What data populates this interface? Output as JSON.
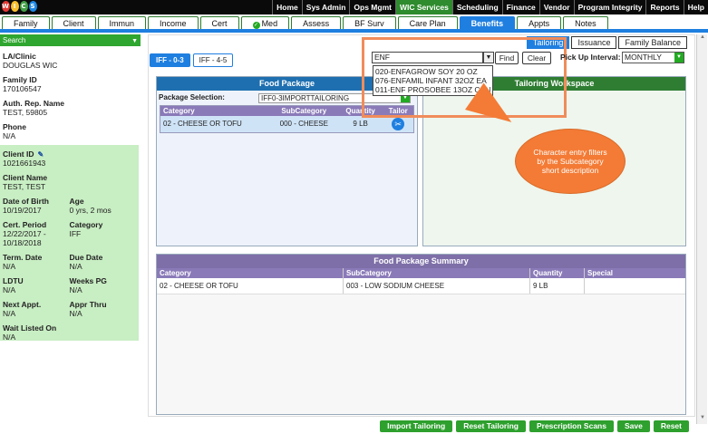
{
  "logo": {
    "text": "WIC"
  },
  "top_menu": [
    "Home",
    "Sys Admin",
    "Ops Mgmt",
    "WIC Services",
    "Scheduling",
    "Finance",
    "Vendor",
    "Program Integrity",
    "Reports",
    "Help"
  ],
  "top_menu_active": "WIC Services",
  "tabs": [
    "Family",
    "Client",
    "Immun",
    "Income",
    "Cert",
    "Med",
    "Assess",
    "BF Surv",
    "Care Plan",
    "Benefits",
    "Appts",
    "Notes"
  ],
  "tabs_active": "Benefits",
  "sidebar": {
    "search_label": "Search",
    "la_clinic_label": "LA/Clinic",
    "la_clinic_value": "DOUGLAS WIC",
    "family_id_label": "Family ID",
    "family_id_value": "170106547",
    "auth_rep_label": "Auth. Rep. Name",
    "auth_rep_value": "TEST, 59805",
    "phone_label": "Phone",
    "phone_value": "N/A",
    "client_id_label": "Client ID",
    "client_id_value": "1021661943",
    "client_name_label": "Client Name",
    "client_name_value": "TEST, TEST",
    "dob_label": "Date of Birth",
    "dob_value": "10/19/2017",
    "age_label": "Age",
    "age_value": "0 yrs, 2 mos",
    "cert_period_label": "Cert. Period",
    "cert_period_value1": "12/22/2017 -",
    "cert_period_value2": "10/18/2018",
    "category_label": "Category",
    "category_value": "IFF",
    "term_date_label": "Term. Date",
    "term_date_value": "N/A",
    "due_date_label": "Due Date",
    "due_date_value": "N/A",
    "ldtu_label": "LDTU",
    "ldtu_value": "N/A",
    "weeks_pg_label": "Weeks PG",
    "weeks_pg_value": "N/A",
    "next_appt_label": "Next Appt.",
    "next_appt_value": "N/A",
    "appr_thru_label": "Appr Thru",
    "appr_thru_value": "N/A",
    "wait_listed_label": "Wait Listed On",
    "wait_listed_value": "N/A"
  },
  "right_tabs": [
    "Tailoring",
    "Issuance",
    "Family Balance"
  ],
  "right_tabs_active": "Tailoring",
  "sub_tabs": [
    "IFF - 0-3",
    "IFF - 4-5"
  ],
  "sub_tabs_active": "IFF - 0-3",
  "subcat_search": {
    "value": "ENF",
    "find_label": "Find",
    "clear_label": "Clear",
    "options": [
      "020-ENFAGROW SOY 20 OZ",
      "076-ENFAMIL INFANT 32OZ EA",
      "011-ENF PROSOBEE 13OZ CAN"
    ]
  },
  "pickup": {
    "label": "Pick Up Interval:",
    "value": "MONTHLY"
  },
  "callout_text": "Character entry filters by the Subcategory short description",
  "food_package": {
    "title": "Food Package",
    "selection_label": "Package Selection:",
    "selection_value": "IFF0-3IMPORTTAILORING",
    "columns": [
      "Category",
      "SubCategory",
      "Quantity",
      "Tailor"
    ],
    "rows": [
      {
        "category": "02 - CHEESE OR TOFU",
        "subcategory": "000 - CHEESE",
        "quantity": "9 LB"
      }
    ]
  },
  "tailoring_workspace": {
    "title": "Tailoring Workspace"
  },
  "summary": {
    "title": "Food Package Summary",
    "columns": [
      "Category",
      "SubCategory",
      "Quantity",
      "Special"
    ],
    "rows": [
      {
        "category": "02 - CHEESE OR TOFU",
        "subcategory": "003 - LOW SODIUM CHEESE",
        "quantity": "9 LB",
        "special": ""
      }
    ]
  },
  "bottom_buttons": [
    "Import Tailoring",
    "Reset Tailoring",
    "Prescription Scans",
    "Save",
    "Reset"
  ],
  "colors": {
    "brand_green": "#2e8b2e",
    "tab_blue": "#1f7fe0",
    "callout_orange": "#f47b35",
    "sidebar_green": "#c8eec3",
    "table_header_purple": "#8a7ab8"
  }
}
